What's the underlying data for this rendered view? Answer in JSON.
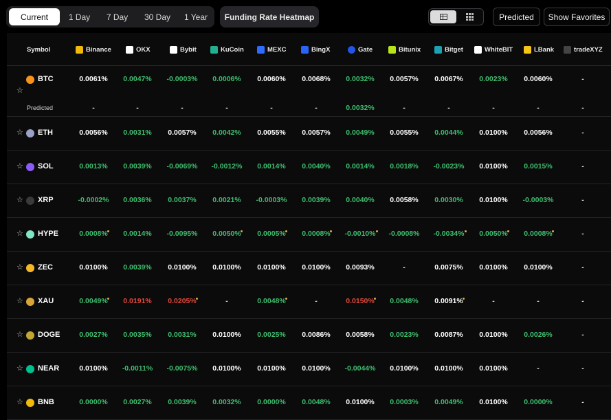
{
  "timeframes": [
    "Current",
    "1 Day",
    "7 Day",
    "30 Day",
    "1 Year"
  ],
  "active_timeframe": "Current",
  "heatmap_label": "Funding Rate Heatmap",
  "predicted_button": "Predicted",
  "favorites_button": "Show Favorites",
  "symbol_header": "Symbol",
  "predicted_row_label": "Predicted",
  "exchanges": [
    {
      "name": "Binance",
      "icon": "binance-icon",
      "color": "#f0b90b"
    },
    {
      "name": "OKX",
      "icon": "okx-icon",
      "color": "#ffffff"
    },
    {
      "name": "Bybit",
      "icon": "bybit-icon",
      "color": "#ffffff"
    },
    {
      "name": "KuCoin",
      "icon": "kucoin-icon",
      "color": "#23af91"
    },
    {
      "name": "MEXC",
      "icon": "mexc-icon",
      "color": "#2f6bff"
    },
    {
      "name": "BingX",
      "icon": "bingx-icon",
      "color": "#2a64f6"
    },
    {
      "name": "Gate",
      "icon": "gate-icon",
      "color": "#2354e6"
    },
    {
      "name": "Bitunix",
      "icon": "bitunix-icon",
      "color": "#b7e31b"
    },
    {
      "name": "Bitget",
      "icon": "bitget-icon",
      "color": "#1da2b4"
    },
    {
      "name": "WhiteBIT",
      "icon": "whitebit-icon",
      "color": "#ffffff"
    },
    {
      "name": "LBank",
      "icon": "lbank-icon",
      "color": "#f5c518"
    },
    {
      "name": "tradeXYZ",
      "icon": "tradexyz-icon",
      "color": "#444444"
    }
  ],
  "rows": [
    {
      "symbol": "BTC",
      "icon": "btc-icon",
      "icon_color": "#f7931a",
      "values": [
        "0.0061%",
        "0.0047%",
        "-0.0003%",
        "0.0006%",
        "0.0060%",
        "0.0068%",
        "0.0032%",
        "0.0057%",
        "0.0067%",
        "0.0023%",
        "0.0060%",
        "-"
      ],
      "tones": [
        "neu",
        "pos",
        "pos",
        "pos",
        "neu",
        "neu",
        "pos",
        "neu",
        "neu",
        "pos",
        "neu",
        "dash"
      ],
      "dots": [],
      "predicted": [
        "-",
        "-",
        "-",
        "-",
        "-",
        "-",
        "0.0032%",
        "-",
        "-",
        "-",
        "-",
        "-"
      ],
      "predicted_tones": [
        "dash",
        "dash",
        "dash",
        "dash",
        "dash",
        "dash",
        "pos",
        "dash",
        "dash",
        "dash",
        "dash",
        "dash"
      ]
    },
    {
      "symbol": "ETH",
      "icon": "eth-icon",
      "icon_color": "#9aa3c7",
      "values": [
        "0.0056%",
        "0.0031%",
        "0.0057%",
        "0.0042%",
        "0.0055%",
        "0.0057%",
        "0.0049%",
        "0.0055%",
        "0.0044%",
        "0.0100%",
        "0.0056%",
        "-"
      ],
      "tones": [
        "neu",
        "pos",
        "neu",
        "pos",
        "neu",
        "neu",
        "pos",
        "neu",
        "pos",
        "neu",
        "neu",
        "dash"
      ],
      "dots": []
    },
    {
      "symbol": "SOL",
      "icon": "sol-icon",
      "icon_color": "#8a5cf6",
      "values": [
        "0.0013%",
        "0.0039%",
        "-0.0069%",
        "-0.0012%",
        "0.0014%",
        "0.0040%",
        "0.0014%",
        "0.0018%",
        "-0.0023%",
        "0.0100%",
        "0.0015%",
        "-"
      ],
      "tones": [
        "pos",
        "pos",
        "pos",
        "pos",
        "pos",
        "pos",
        "pos",
        "pos",
        "pos",
        "neu",
        "pos",
        "dash"
      ],
      "dots": []
    },
    {
      "symbol": "XRP",
      "icon": "xrp-icon",
      "icon_color": "#3a3a3a",
      "values": [
        "-0.0002%",
        "0.0036%",
        "0.0037%",
        "0.0021%",
        "-0.0003%",
        "0.0039%",
        "0.0040%",
        "0.0058%",
        "0.0030%",
        "0.0100%",
        "-0.0003%",
        "-"
      ],
      "tones": [
        "pos",
        "pos",
        "pos",
        "pos",
        "pos",
        "pos",
        "pos",
        "neu",
        "pos",
        "neu",
        "pos",
        "dash"
      ],
      "dots": []
    },
    {
      "symbol": "HYPE",
      "icon": "hype-icon",
      "icon_color": "#7fe6c6",
      "values": [
        "0.0008%",
        "0.0014%",
        "-0.0095%",
        "0.0050%",
        "0.0005%",
        "0.0008%",
        "-0.0010%",
        "-0.0008%",
        "-0.0034%",
        "0.0050%",
        "0.0008%",
        "-"
      ],
      "tones": [
        "pos",
        "pos",
        "pos",
        "pos",
        "pos",
        "pos",
        "pos",
        "pos",
        "pos",
        "pos",
        "pos",
        "dash"
      ],
      "dots": [
        0,
        3,
        4,
        5,
        6,
        8,
        9,
        10
      ]
    },
    {
      "symbol": "ZEC",
      "icon": "zec-icon",
      "icon_color": "#f4b728",
      "values": [
        "0.0100%",
        "0.0039%",
        "0.0100%",
        "0.0100%",
        "0.0100%",
        "0.0100%",
        "0.0093%",
        "-",
        "0.0075%",
        "0.0100%",
        "0.0100%",
        "-"
      ],
      "tones": [
        "neu",
        "pos",
        "neu",
        "neu",
        "neu",
        "neu",
        "neu",
        "dash",
        "neu",
        "neu",
        "neu",
        "dash"
      ],
      "dots": []
    },
    {
      "symbol": "XAU",
      "icon": "xau-icon",
      "icon_color": "#d9a43a",
      "values": [
        "0.0049%",
        "0.0191%",
        "0.0205%",
        "-",
        "0.0048%",
        "-",
        "0.0150%",
        "0.0048%",
        "0.0091%",
        "-",
        "-",
        "-"
      ],
      "tones": [
        "pos",
        "neg",
        "neg",
        "dash",
        "pos",
        "dash",
        "neg",
        "pos",
        "neu",
        "dash",
        "dash",
        "dash"
      ],
      "dots": [
        0,
        2,
        4,
        6,
        8
      ]
    },
    {
      "symbol": "DOGE",
      "icon": "doge-icon",
      "icon_color": "#c2a633",
      "values": [
        "0.0027%",
        "0.0035%",
        "0.0031%",
        "0.0100%",
        "0.0025%",
        "0.0086%",
        "0.0058%",
        "0.0023%",
        "0.0087%",
        "0.0100%",
        "0.0026%",
        "-"
      ],
      "tones": [
        "pos",
        "pos",
        "pos",
        "neu",
        "pos",
        "neu",
        "neu",
        "pos",
        "neu",
        "neu",
        "pos",
        "dash"
      ],
      "dots": []
    },
    {
      "symbol": "NEAR",
      "icon": "near-icon",
      "icon_color": "#00c08b",
      "values": [
        "0.0100%",
        "-0.0011%",
        "-0.0075%",
        "0.0100%",
        "0.0100%",
        "0.0100%",
        "-0.0044%",
        "0.0100%",
        "0.0100%",
        "0.0100%",
        "-",
        "-"
      ],
      "tones": [
        "neu",
        "pos",
        "pos",
        "neu",
        "neu",
        "neu",
        "pos",
        "neu",
        "neu",
        "neu",
        "dash",
        "dash"
      ],
      "dots": []
    },
    {
      "symbol": "BNB",
      "icon": "bnb-icon",
      "icon_color": "#f0b90b",
      "values": [
        "0.0000%",
        "0.0027%",
        "0.0039%",
        "0.0032%",
        "0.0000%",
        "0.0048%",
        "0.0100%",
        "0.0003%",
        "0.0049%",
        "0.0100%",
        "0.0000%",
        "-"
      ],
      "tones": [
        "pos",
        "pos",
        "pos",
        "pos",
        "pos",
        "pos",
        "neu",
        "pos",
        "pos",
        "neu",
        "pos",
        "dash"
      ],
      "dots": []
    }
  ]
}
